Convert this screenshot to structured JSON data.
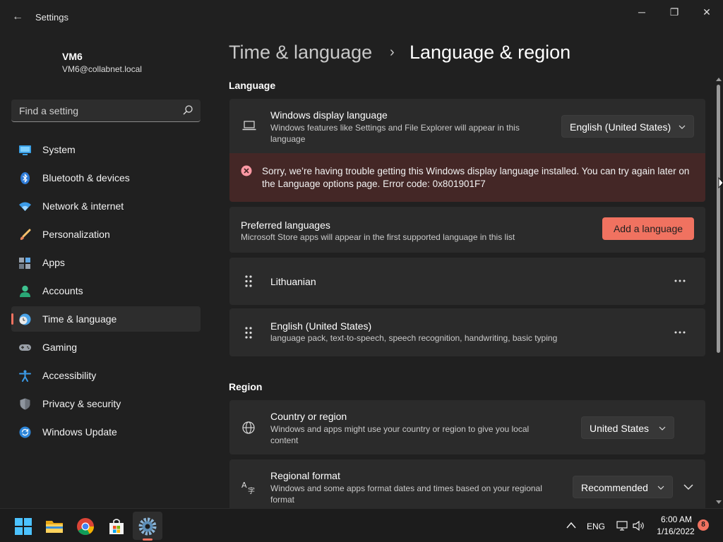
{
  "window": {
    "title": "Settings",
    "back_glyph": "←",
    "minimize_glyph": "─",
    "maximize_glyph": "❐",
    "close_glyph": "✕"
  },
  "profile": {
    "name": "VM6",
    "email": "VM6@collabnet.local"
  },
  "search": {
    "placeholder": "Find a setting"
  },
  "nav": {
    "items": [
      {
        "label": "System",
        "icon": "system-icon"
      },
      {
        "label": "Bluetooth & devices",
        "icon": "bluetooth-icon"
      },
      {
        "label": "Network & internet",
        "icon": "wifi-icon"
      },
      {
        "label": "Personalization",
        "icon": "brush-icon"
      },
      {
        "label": "Apps",
        "icon": "apps-icon"
      },
      {
        "label": "Accounts",
        "icon": "account-icon"
      },
      {
        "label": "Time & language",
        "icon": "globe-clock-icon",
        "active": true
      },
      {
        "label": "Gaming",
        "icon": "gamepad-icon"
      },
      {
        "label": "Accessibility",
        "icon": "accessibility-icon"
      },
      {
        "label": "Privacy & security",
        "icon": "shield-icon"
      },
      {
        "label": "Windows Update",
        "icon": "update-icon"
      }
    ]
  },
  "breadcrumb": {
    "parent": "Time & language",
    "separator": "›",
    "current": "Language & region"
  },
  "language_section": {
    "title": "Language",
    "display_language": {
      "title": "Windows display language",
      "desc": "Windows features like Settings and File Explorer will appear in this language",
      "value": "English (United States)"
    },
    "error": {
      "message": "Sorry, we’re having trouble getting this Windows display language installed. You can try again later on the Language options page. Error code: 0x801901F7"
    },
    "preferred": {
      "title": "Preferred languages",
      "desc": "Microsoft Store apps will appear in the first supported language in this list",
      "button": "Add a language"
    },
    "languages": [
      {
        "name": "Lithuanian",
        "desc": ""
      },
      {
        "name": "English (United States)",
        "desc": "language pack, text-to-speech, speech recognition, handwriting, basic typing"
      }
    ]
  },
  "region_section": {
    "title": "Region",
    "country": {
      "title": "Country or region",
      "desc": "Windows and apps might use your country or region to give you local content",
      "value": "United States"
    },
    "format": {
      "title": "Regional format",
      "desc": "Windows and some apps format dates and times based on your regional format",
      "value": "Recommended"
    }
  },
  "taskbar": {
    "apps": [
      "start-icon",
      "file-explorer-icon",
      "chrome-icon",
      "store-icon",
      "settings-icon"
    ],
    "language": "ENG",
    "time": "6:00 AM",
    "date": "1/16/2022",
    "notifications": "8"
  },
  "colors": {
    "accent": "#f07260",
    "error_bg": "#442726",
    "card_bg": "#2b2b2b",
    "window_bg": "#202020"
  }
}
